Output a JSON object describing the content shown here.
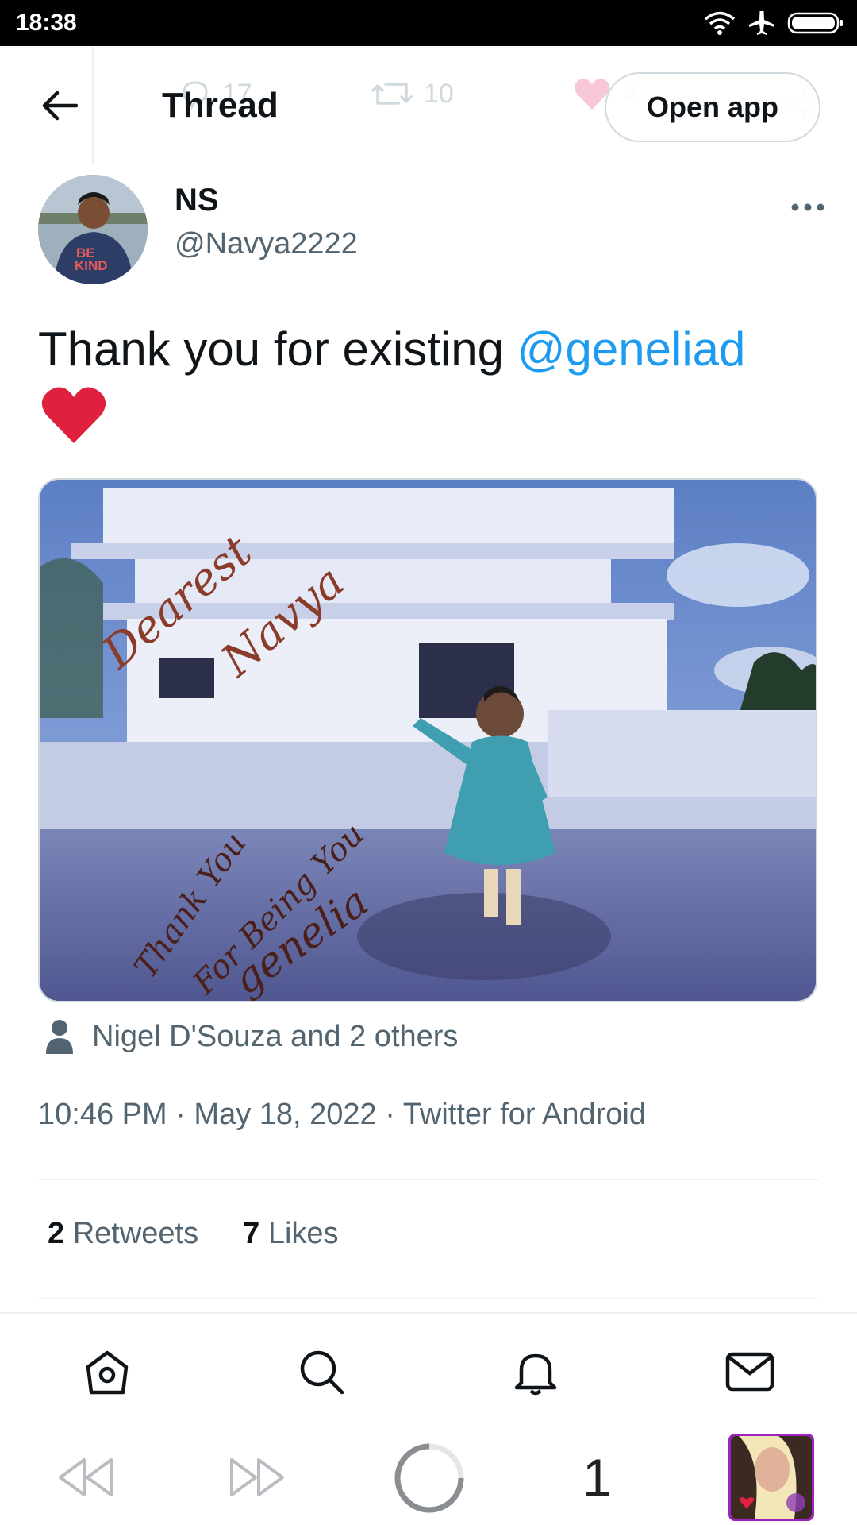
{
  "status_bar": {
    "time": "18:38"
  },
  "header": {
    "title": "Thread",
    "open_app": "Open app",
    "ghost_reply_count": "17",
    "ghost_retweet_count": "10",
    "ghost_like_count": "4"
  },
  "tweet": {
    "author_name": "NS",
    "author_handle": "@Navya2222",
    "avatar_text": "BE KIND",
    "text": "Thank you for existing ",
    "mention": "@geneliad",
    "emoji": "heart",
    "image_alt": "Autographed childhood photo",
    "image_handwriting": {
      "top": "Dearest Navya",
      "bottom": "Thank You For Being You genelia"
    },
    "tagged": "Nigel D'Souza and 2 others",
    "timestamp": "10:46 PM · May 18, 2022 · Twitter for Android",
    "retweets_count": "2",
    "retweets_label": "Retweets",
    "likes_count": "7",
    "likes_label": "Likes"
  },
  "bottom_nav": {
    "items": [
      "home-icon",
      "search-icon",
      "notifications-icon",
      "messages-icon"
    ]
  },
  "browser_bar": {
    "tab_count": "1"
  },
  "colors": {
    "accent": "#1d9bf0",
    "text": "#0f1419",
    "secondary": "#536471",
    "heart": "#e0245e"
  }
}
